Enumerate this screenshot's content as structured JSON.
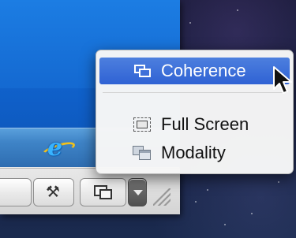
{
  "menu": {
    "items": [
      {
        "label": "Coherence",
        "icon": "coherence-icon",
        "selected": true
      },
      {
        "label": "Full Screen",
        "icon": "fullscreen-icon",
        "selected": false
      },
      {
        "label": "Modality",
        "icon": "modality-icon",
        "selected": false
      }
    ]
  },
  "toolbar": {
    "buttons": [
      {
        "icon": "tools-icon"
      },
      {
        "icon": "view-mode-icon"
      },
      {
        "icon": "chevron-down-icon"
      }
    ]
  },
  "taskbar": {
    "pinned": [
      {
        "icon": "internet-explorer-icon"
      }
    ]
  },
  "colors": {
    "selection": "#2f62d4",
    "vm_desktop": "#1469d1",
    "taskbar": "#3f84c7"
  }
}
